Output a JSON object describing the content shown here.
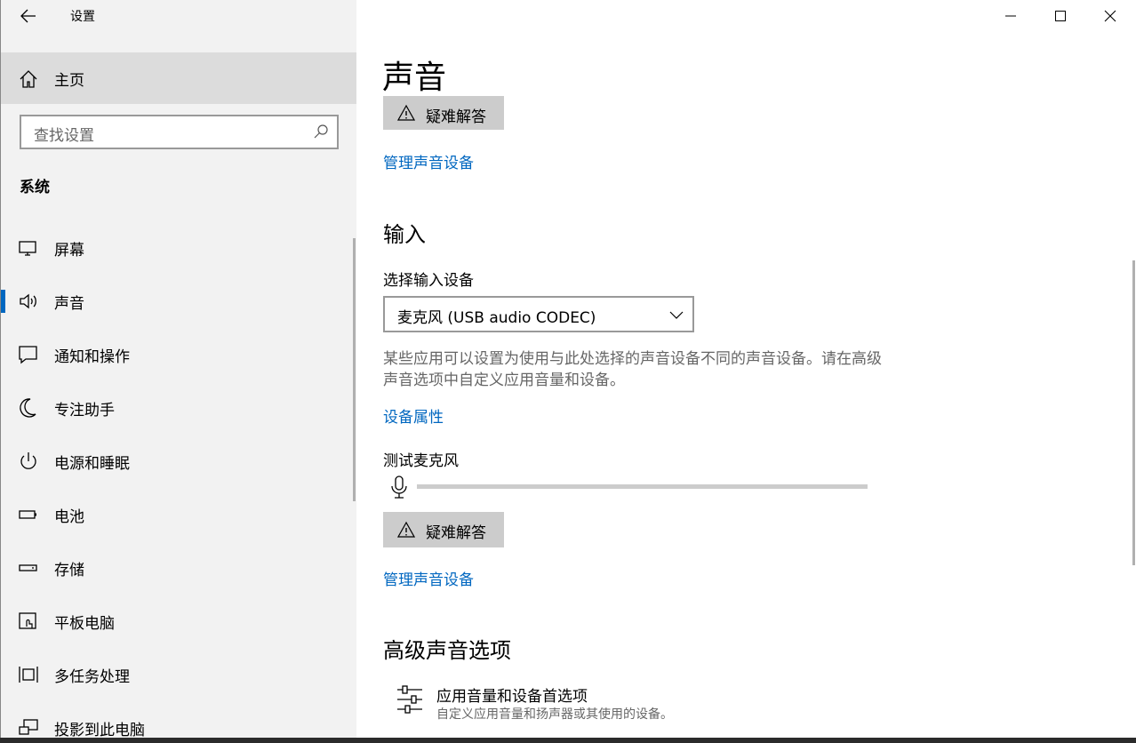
{
  "window": {
    "title": "设置"
  },
  "sidebar": {
    "home_label": "主页",
    "search_placeholder": "查找设置",
    "section_title": "系统",
    "items": [
      {
        "label": "屏幕",
        "icon": "monitor-icon"
      },
      {
        "label": "声音",
        "icon": "speaker-icon",
        "active": true
      },
      {
        "label": "通知和操作",
        "icon": "notification-icon"
      },
      {
        "label": "专注助手",
        "icon": "moon-icon"
      },
      {
        "label": "电源和睡眠",
        "icon": "power-icon"
      },
      {
        "label": "电池",
        "icon": "battery-icon"
      },
      {
        "label": "存储",
        "icon": "storage-icon"
      },
      {
        "label": "平板电脑",
        "icon": "tablet-icon"
      },
      {
        "label": "多任务处理",
        "icon": "multitasking-icon"
      },
      {
        "label": "投影到此电脑",
        "icon": "project-icon"
      }
    ]
  },
  "content": {
    "page_title": "声音",
    "output_troubleshoot_label": "疑难解答",
    "output_manage_link": "管理声音设备",
    "input_heading": "输入",
    "input_device_label": "选择输入设备",
    "input_device_value": "麦克风 (USB audio CODEC)",
    "input_description": "某些应用可以设置为使用与此处选择的声音设备不同的声音设备。请在高级声音选项中自定义应用音量和设备。",
    "device_properties_link": "设备属性",
    "test_mic_label": "测试麦克风",
    "mic_level": 0,
    "input_troubleshoot_label": "疑难解答",
    "input_manage_link": "管理声音设备",
    "advanced_heading": "高级声音选项",
    "advanced_item_title": "应用音量和设备首选项",
    "advanced_item_desc": "自定义应用音量和扬声器或其使用的设备。"
  },
  "colors": {
    "accent": "#0067c0",
    "sidebar_bg": "#f2f2f2",
    "home_highlight": "#dcdcdc",
    "button_bg": "#cccccc"
  }
}
